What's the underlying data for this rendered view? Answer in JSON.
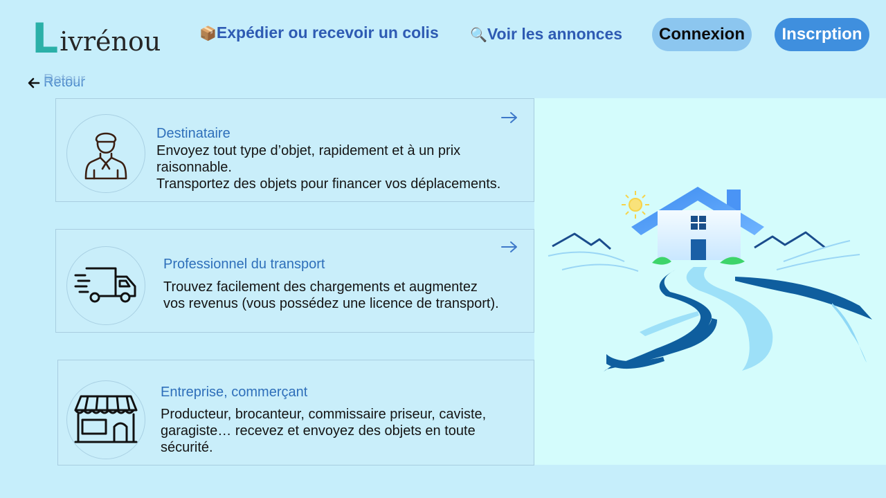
{
  "header": {
    "logo": {
      "first_letter": "L",
      "rest": "ivrénou"
    },
    "nav": {
      "ship": {
        "icon": "package-icon",
        "emoji": "📦",
        "label": "Expédier ou recevoir un colis"
      },
      "ads": {
        "icon": "magnifier-icon",
        "emoji": "🔍",
        "label": "Voir les annonces"
      }
    },
    "login_label": "Connexion",
    "signup_label": "Inscrption"
  },
  "back": {
    "label": "Retour",
    "icon": "arrow-left-icon"
  },
  "cards": [
    {
      "title": "Destinataire",
      "icon": "person-icon",
      "lines": [
        "Envoyez tout type d’objet, rapidement et à un prix",
        "raisonnable.",
        "Transportez des objets pour financer vos déplacements."
      ]
    },
    {
      "title": "Professionnel du transport",
      "icon": "delivery-truck-icon",
      "lines": [
        "Trouvez facilement des chargements et augmentez",
        "vos revenus (vous possédez une licence de transport)."
      ]
    },
    {
      "title": "Entreprise, commerçant",
      "icon": "storefront-icon",
      "lines": [
        "Producteur, brocanteur, commissaire priseur, caviste,",
        "garagiste… recevez et envoyez des objets en toute",
        "sécurité."
      ]
    }
  ],
  "colors": {
    "background": "#c6eefb",
    "accent": "#3f8fde",
    "login_bg": "#8cc6ef",
    "card_title": "#2e6fba",
    "logo_l": "#2bb0a8"
  }
}
